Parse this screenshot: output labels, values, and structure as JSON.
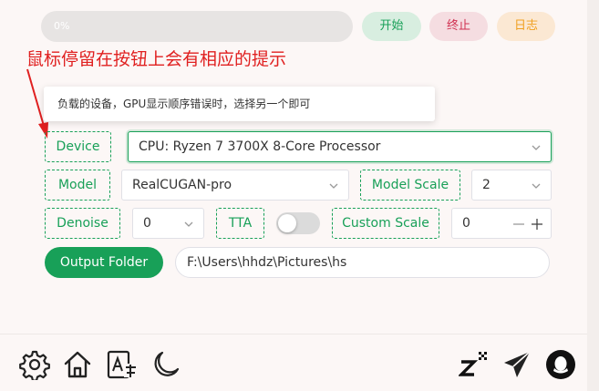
{
  "progress": {
    "value": 0,
    "text": "0%"
  },
  "actions": {
    "start": "开始",
    "stop": "终止",
    "log": "日志"
  },
  "annotation": "鼠标停留在按钮上会有相应的提示",
  "tooltip": "负载的设备，GPU显示顺序错误时，选择另一个即可",
  "device": {
    "label": "Device",
    "value": "CPU: Ryzen 7 3700X 8-Core Processor"
  },
  "model": {
    "label": "Model",
    "value": "RealCUGAN-pro"
  },
  "model_scale": {
    "label": "Model Scale",
    "value": "2"
  },
  "denoise": {
    "label": "Denoise",
    "value": "0"
  },
  "tta": {
    "label": "TTA",
    "enabled": false
  },
  "custom_scale": {
    "label": "Custom Scale",
    "value": "0"
  },
  "output": {
    "button": "Output Folder",
    "path": "F:\\Users\\hhdz\\Pictures\\hs"
  },
  "footer": {
    "icons": [
      "gear-icon",
      "home-icon",
      "translate-icon",
      "moon-icon",
      "sleep-z-icon",
      "send-icon",
      "qq-icon"
    ]
  },
  "colors": {
    "accent": "#18a058",
    "danger": "#d03050",
    "warning": "#f0a020",
    "annotation": "#e02020"
  }
}
